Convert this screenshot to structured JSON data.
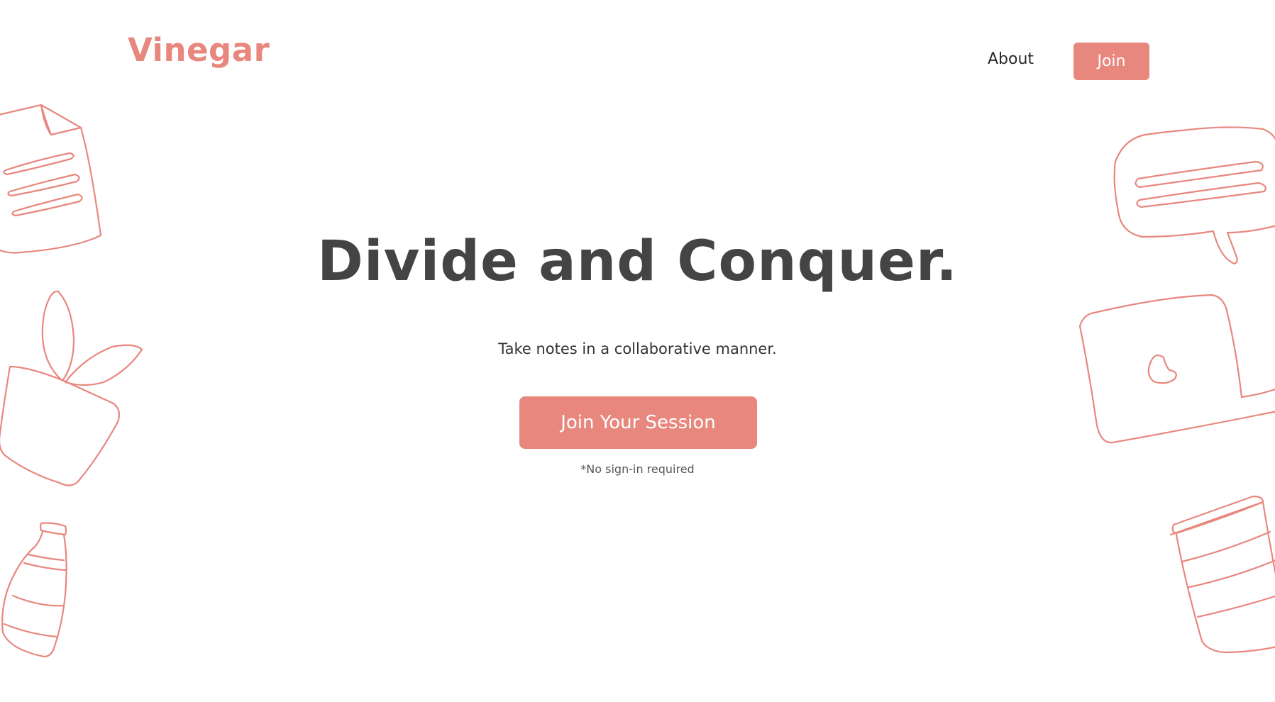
{
  "header": {
    "logo": "Vinegar",
    "nav": {
      "about_label": "About",
      "join_label": "Join"
    }
  },
  "hero": {
    "title": "Divide and Conquer.",
    "subtitle": "Take notes in a collaborative manner.",
    "cta_label": "Join Your Session",
    "cta_note": "*No sign-in required"
  },
  "theme": {
    "accent": "#e8877e",
    "heading": "#444444",
    "text": "#333333",
    "background": "#ffffff"
  },
  "icons": [
    "document-icon",
    "plant-icon",
    "bottle-icon",
    "chat-bubble-icon",
    "laptop-icon",
    "coffee-cup-icon"
  ]
}
